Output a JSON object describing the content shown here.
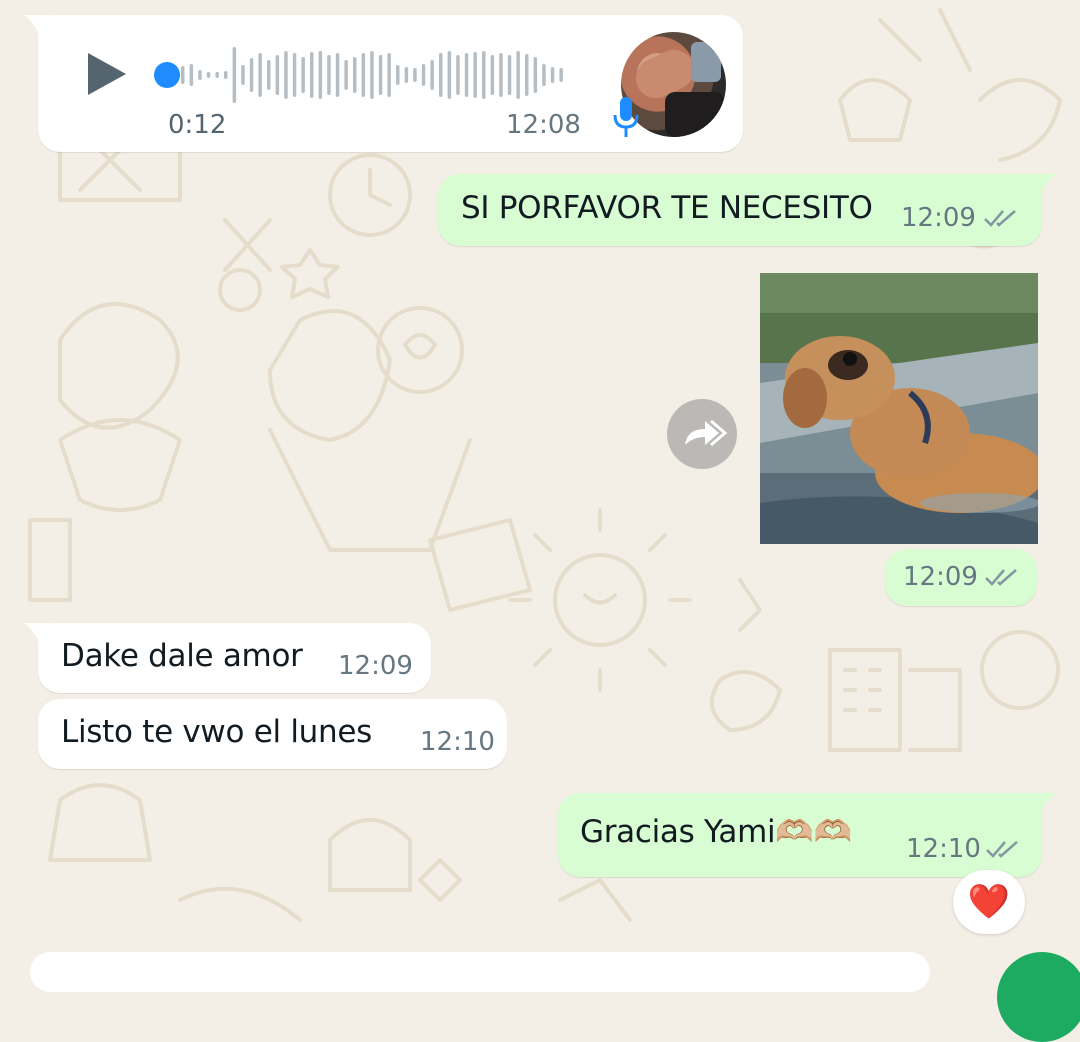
{
  "chat": {
    "voice_message": {
      "duration": "0:12",
      "time": "12:08",
      "play_icon": "play-icon",
      "mic_icon": "mic-icon",
      "avatar_icon": "avatar-photo"
    },
    "messages": [
      {
        "text": "SI PORFAVOR TE NECESITO",
        "time": "12:09",
        "direction": "outgoing",
        "status": "read"
      },
      {
        "type": "image",
        "time": "12:09",
        "direction": "outgoing",
        "status": "read",
        "forward_icon": "forward-icon"
      },
      {
        "text": "Dake dale amor",
        "time": "12:09",
        "direction": "incoming"
      },
      {
        "text": "Listo te vwo el lunes",
        "time": "12:10",
        "direction": "incoming"
      },
      {
        "text": "Gracias Yami🫶🏼🫶🏼",
        "time": "12:10",
        "direction": "outgoing",
        "status": "read",
        "reaction": "❤️"
      }
    ]
  },
  "colors": {
    "outgoing_bubble": "#d9fdd3",
    "incoming_bubble": "#ffffff",
    "read_ticks": "#8696a0",
    "voice_dot": "#1e8cff",
    "wallpaper": "#f4efe6"
  }
}
